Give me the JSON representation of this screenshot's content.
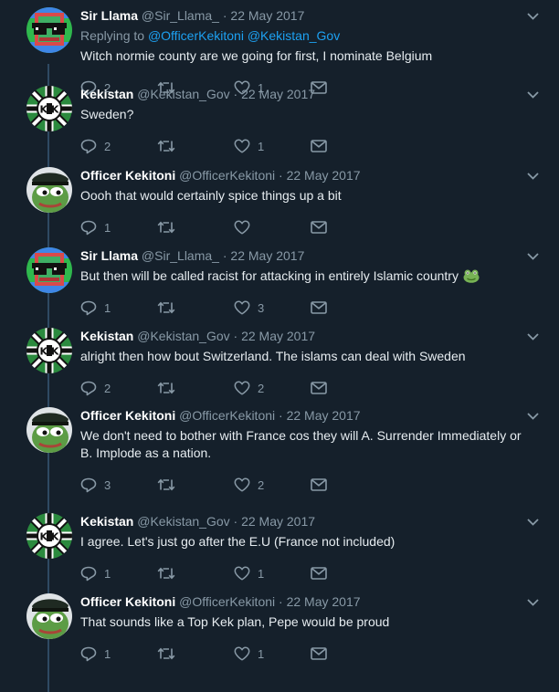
{
  "tweets": [
    {
      "name": "Sir Llama",
      "handle": "@Sir_Llama_",
      "dot": "·",
      "date": "22 May 2017",
      "replying_label": "Replying to",
      "replying_to": "@OfficerKekitoni @Kekistan_Gov",
      "text": "Witch normie county are we going for first, I nominate Belgium",
      "replies": "2",
      "retweets": "",
      "likes": "1",
      "avatar": "llama-avatar"
    },
    {
      "name": "Kekistan",
      "handle": "@Kekistan_Gov",
      "dot": "·",
      "date": "22 May 2017",
      "text": "Sweden?",
      "replies": "2",
      "retweets": "",
      "likes": "1",
      "avatar": "kekistan-flag-avatar"
    },
    {
      "name": "Officer Kekitoni",
      "handle": "@OfficerKekitoni",
      "dot": "·",
      "date": "22 May 2017",
      "text": "Oooh that would certainly spice things up a bit",
      "replies": "1",
      "retweets": "",
      "likes": "",
      "avatar": "pepe-avatar"
    },
    {
      "name": "Sir Llama",
      "handle": "@Sir_Llama_",
      "dot": "·",
      "date": "22 May 2017",
      "text": "But then will be called racist for attacking in entirely Islamic country",
      "emoji": "frog-emoji",
      "replies": "1",
      "retweets": "",
      "likes": "3",
      "avatar": "llama-avatar"
    },
    {
      "name": "Kekistan",
      "handle": "@Kekistan_Gov",
      "dot": "·",
      "date": "22 May 2017",
      "text": "alright then how bout Switzerland. The islams can deal with Sweden",
      "replies": "2",
      "retweets": "",
      "likes": "2",
      "avatar": "kekistan-flag-avatar"
    },
    {
      "name": "Officer Kekitoni",
      "handle": "@OfficerKekitoni",
      "dot": "·",
      "date": "22 May 2017",
      "text": "We don't need to bother with France cos they will A. Surrender Immediately or B. Implode as a nation.",
      "replies": "3",
      "retweets": "",
      "likes": "2",
      "avatar": "pepe-avatar"
    },
    {
      "name": "Kekistan",
      "handle": "@Kekistan_Gov",
      "dot": "·",
      "date": "22 May 2017",
      "text": "I agree. Let's just go after the E.U (France not included)",
      "replies": "1",
      "retweets": "",
      "likes": "1",
      "avatar": "kekistan-flag-avatar"
    },
    {
      "name": "Officer Kekitoni",
      "handle": "@OfficerKekitoni",
      "dot": "·",
      "date": "22 May 2017",
      "text": "That sounds like a Top Kek plan, Pepe would be proud",
      "replies": "1",
      "retweets": "",
      "likes": "1",
      "avatar": "pepe-avatar"
    }
  ],
  "icons": {
    "reply": "reply-icon",
    "retweet": "retweet-icon",
    "like": "heart-icon",
    "dm": "envelope-icon",
    "caret": "chevron-down-icon"
  },
  "colors": {
    "background": "#15202b",
    "muted": "#8899a6",
    "link": "#1da1f2",
    "thread_line": "#2f4a63",
    "text": "#e6ecf0"
  }
}
